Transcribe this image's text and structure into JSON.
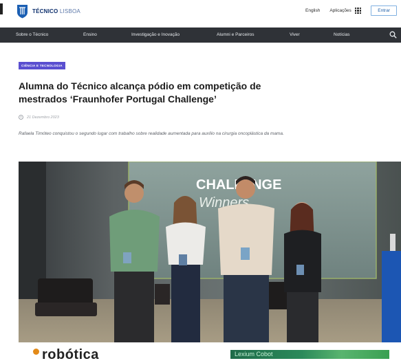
{
  "header": {
    "brand_bold": "TÉCNICO",
    "brand_light": "LISBOA",
    "language": "English",
    "apps_label": "Aplicações",
    "enter_label": "Entrar"
  },
  "nav": {
    "items": [
      "Sobre o Técnico",
      "Ensino",
      "Investigação e Inovação",
      "Alumni e Parceiros",
      "Viver",
      "Notícias"
    ]
  },
  "article": {
    "category": "CIÊNCIA E TECNOLOGIA",
    "title": "Alumna do Técnico alcança pódio em competição de mestrados ‘Fraunhofer Portugal Challenge’",
    "date": "21 Dezembro 2023",
    "lead": "Rafaela Timóteo conquistou o segundo lugar com trabalho sobre realidade aumentada para auxílio na cirurgia oncoplástica da mama.",
    "photo_text_1": "CHALLENGE",
    "photo_text_2": "Winners"
  },
  "ads": {
    "left_text": "robótica",
    "right_text": "Lexium Cobot"
  },
  "colors": {
    "nav_bg": "#2f3237",
    "tag_bg": "#5a4fd0",
    "brand_blue": "#0b2d6b"
  }
}
